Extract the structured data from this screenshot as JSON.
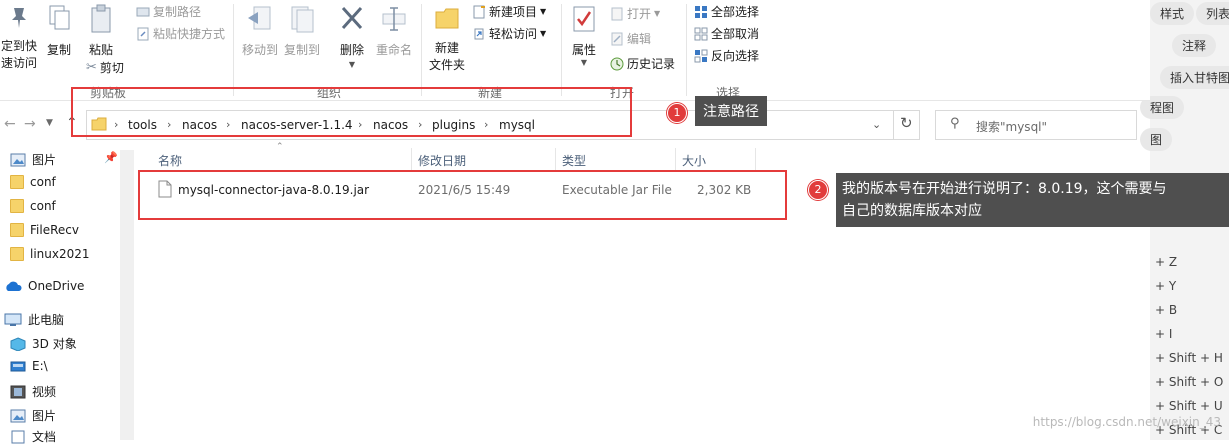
{
  "ribbon": {
    "clipboard": {
      "pin_label_1": "定到快",
      "pin_label_2": "速访问",
      "copy": "复制",
      "paste": "粘贴",
      "copy_path": "复制路径",
      "paste_shortcut": "粘贴快捷方式",
      "cut": "剪切",
      "group": "剪贴板"
    },
    "organize": {
      "move_to": "移动到",
      "copy_to": "复制到",
      "delete": "删除",
      "rename": "重命名",
      "group": "组织"
    },
    "new": {
      "new_folder_1": "新建",
      "new_folder_2": "文件夹",
      "new_item": "新建项目",
      "easy_access": "轻松访问",
      "group": "新建"
    },
    "open": {
      "properties": "属性",
      "open": "打开",
      "edit": "编辑",
      "history": "历史记录",
      "group": "打开"
    },
    "select": {
      "select_all": "全部选择",
      "select_none": "全部取消",
      "invert": "反向选择",
      "group": "选择"
    }
  },
  "address": {
    "crumbs": [
      "tools",
      "nacos",
      "nacos-server-1.1.4",
      "nacos",
      "plugins",
      "mysql"
    ]
  },
  "search": {
    "placeholder": "搜索\"mysql\""
  },
  "nav": {
    "items": [
      {
        "label": "图片"
      },
      {
        "label": "conf"
      },
      {
        "label": "conf"
      },
      {
        "label": "FileRecv"
      },
      {
        "label": "linux2021"
      },
      {
        "label": "OneDrive"
      },
      {
        "label": "此电脑"
      },
      {
        "label": "3D 对象"
      },
      {
        "label": "E:\\"
      },
      {
        "label": "视频"
      },
      {
        "label": "图片"
      },
      {
        "label": "文档"
      }
    ]
  },
  "table": {
    "columns": [
      "名称",
      "修改日期",
      "类型",
      "大小"
    ],
    "rows": [
      {
        "name": "mysql-connector-java-8.0.19.jar",
        "date": "2021/6/5 15:49",
        "type": "Executable Jar File",
        "size": "2,302 KB"
      }
    ]
  },
  "annotations": {
    "one": {
      "num": "1",
      "text": "注意路径"
    },
    "two": {
      "num": "2",
      "line1": "我的版本号在开始进行说明了：8.0.19，这个需要与",
      "line2": "自己的数据库版本对应"
    }
  },
  "backdrop": {
    "chips": [
      "样式",
      "列表",
      "注释",
      "插入甘特图",
      "程图",
      "图"
    ],
    "shortcuts": [
      "+ Z",
      "+ Y",
      "+ B",
      "+ I",
      "+ Shift + H",
      "+ Shift + O",
      "+ Shift + U",
      "+ Shift + C"
    ],
    "watermark": "https://blog.csdn.net/weixin_43"
  },
  "colors": {
    "accent": "#e43b3b",
    "callout_bg": "#4f4f4f",
    "folder": "#f6d36a"
  }
}
